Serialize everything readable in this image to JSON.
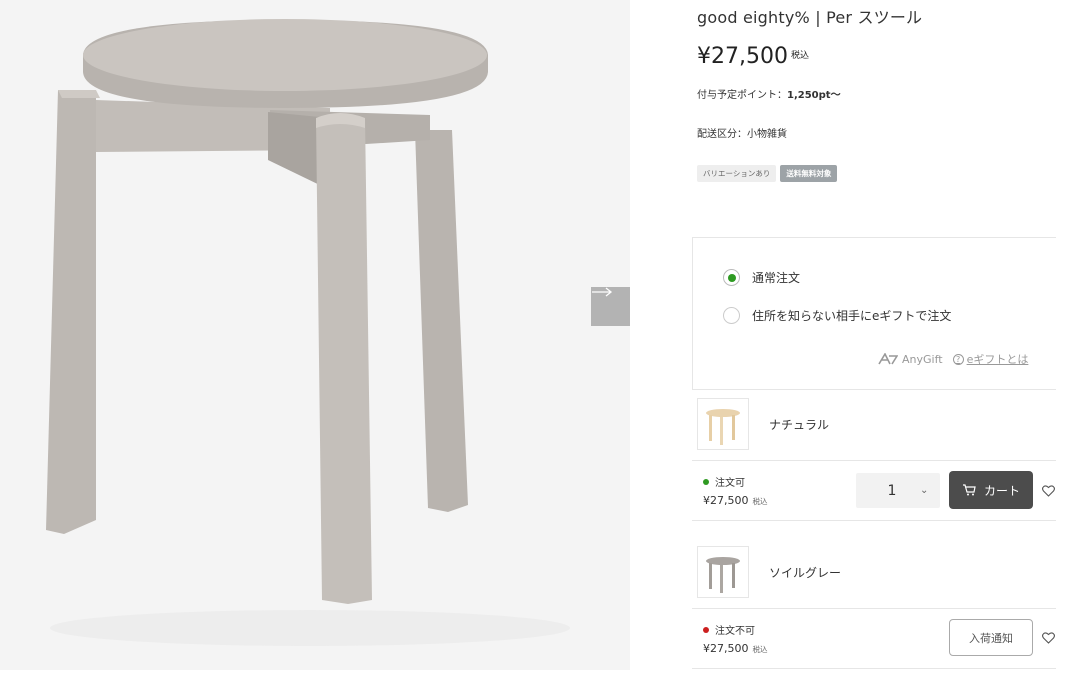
{
  "product": {
    "title": "good eighty% | Per スツール",
    "price": "¥27,500",
    "price_tax": "税込",
    "points_label": "付与予定ポイント：",
    "points_value": "1,250pt〜",
    "delivery": "配送区分：小物雑貨",
    "tags": [
      "バリエーションあり",
      "送料無料対象"
    ]
  },
  "order_options": {
    "normal": "通常注文",
    "gift": "住所を知らない相手にeギフトで注文",
    "anygift_brand": "AnyGift",
    "help_link": "eギフトとは",
    "selected": "normal"
  },
  "variants": [
    {
      "name": "ナチュラル",
      "status": "注文可",
      "status_color": "#2e9a22",
      "price": "¥27,500",
      "tax": "税込",
      "quantity": "1",
      "button": "カート"
    },
    {
      "name": "ソイルグレー",
      "status": "注文不可",
      "status_color": "#cc1f1f",
      "price": "¥27,500",
      "tax": "税込",
      "button": "入荷通知"
    }
  ],
  "icons": {
    "next": "arrow-right-icon",
    "cart": "cart-icon",
    "favorite": "heart-icon",
    "anygift": "anygift-logo-icon",
    "help": "question-circle-icon"
  }
}
